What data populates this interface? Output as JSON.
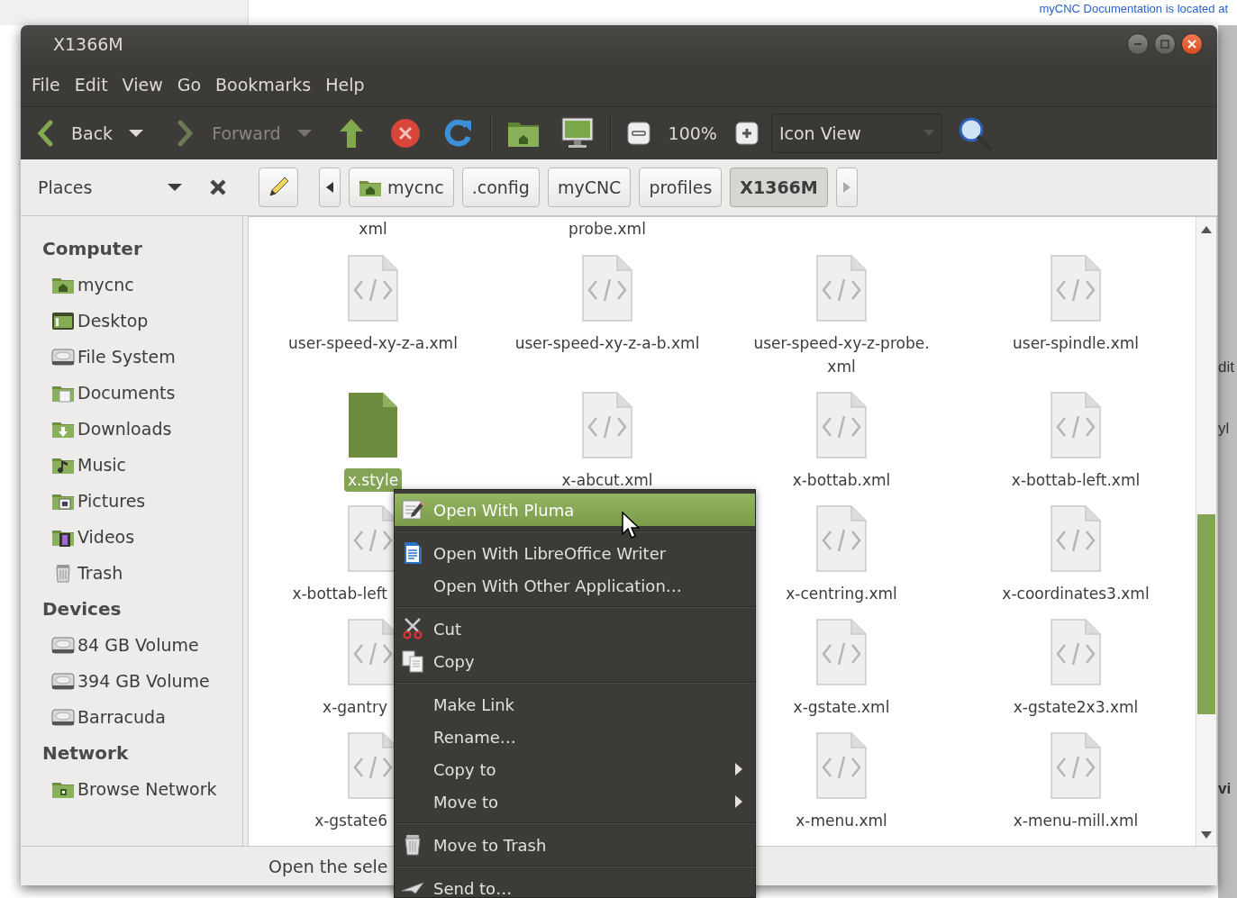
{
  "background": {
    "link_text": "myCNC Documentation is located at",
    "edge_fragments": [
      "dit",
      "yl",
      "vi"
    ]
  },
  "window": {
    "title": "X1366M"
  },
  "menubar": [
    "File",
    "Edit",
    "View",
    "Go",
    "Bookmarks",
    "Help"
  ],
  "toolbar": {
    "back": {
      "label": "Back",
      "disabled": false
    },
    "forward": {
      "label": "Forward",
      "disabled": true
    },
    "zoom_level": "100%",
    "view_mode": "Icon View"
  },
  "location_bar": {
    "places_label": "Places",
    "path": [
      {
        "label": "mycnc",
        "selected": false,
        "home": true
      },
      {
        "label": ".config",
        "selected": false,
        "home": false
      },
      {
        "label": "myCNC",
        "selected": false,
        "home": false
      },
      {
        "label": "profiles",
        "selected": false,
        "home": false
      },
      {
        "label": "X1366M",
        "selected": true,
        "home": false
      }
    ]
  },
  "sidebar": {
    "sections": [
      {
        "heading": "Computer",
        "items": [
          {
            "label": "mycnc",
            "kind": "home"
          },
          {
            "label": "Desktop",
            "kind": "desktop"
          },
          {
            "label": "File System",
            "kind": "drive"
          },
          {
            "label": "Documents",
            "kind": "documents"
          },
          {
            "label": "Downloads",
            "kind": "downloads"
          },
          {
            "label": "Music",
            "kind": "music"
          },
          {
            "label": "Pictures",
            "kind": "pictures"
          },
          {
            "label": "Videos",
            "kind": "videos"
          },
          {
            "label": "Trash",
            "kind": "trash"
          }
        ]
      },
      {
        "heading": "Devices",
        "items": [
          {
            "label": "84 GB Volume",
            "kind": "drive"
          },
          {
            "label": "394 GB Volume",
            "kind": "drive"
          },
          {
            "label": "Barracuda",
            "kind": "drive"
          }
        ]
      },
      {
        "heading": "Network",
        "items": [
          {
            "label": "Browse Network",
            "kind": "network"
          }
        ]
      }
    ]
  },
  "icon_view": {
    "rows": [
      {
        "files": [
          {
            "name": "xml",
            "kind": "label-only",
            "selected": false,
            "truncated": false
          },
          {
            "name": "probe.xml",
            "kind": "label-only",
            "selected": false,
            "truncated": false
          }
        ]
      },
      {
        "files": [
          {
            "name": "user-speed-xy-z-a.xml",
            "kind": "xml",
            "selected": false,
            "truncated": false
          },
          {
            "name": "user-speed-xy-z-a-b.xml",
            "kind": "xml",
            "selected": false,
            "truncated": false
          },
          {
            "name": "user-speed-xy-z-probe.xml",
            "kind": "xml",
            "selected": false,
            "truncated": false
          },
          {
            "name": "user-spindle.xml",
            "kind": "xml",
            "selected": false,
            "truncated": false
          }
        ]
      },
      {
        "files": [
          {
            "name": "x.style",
            "kind": "style",
            "selected": true,
            "truncated": false
          },
          {
            "name": "x-abcut.xml",
            "kind": "xml",
            "selected": false,
            "truncated": false
          },
          {
            "name": "x-bottab.xml",
            "kind": "xml",
            "selected": false,
            "truncated": false
          },
          {
            "name": "x-bottab-left.xml",
            "kind": "xml",
            "selected": false,
            "truncated": false
          }
        ]
      },
      {
        "files": [
          {
            "name": "x-bottab-left",
            "kind": "xml",
            "selected": false,
            "truncated": true
          },
          {
            "name": "x-centring.xml",
            "kind": "xml",
            "selected": false,
            "truncated": false
          },
          {
            "name": "x-coordinates3.xml",
            "kind": "xml",
            "selected": false,
            "truncated": false
          }
        ]
      },
      {
        "files": [
          {
            "name": "x-gantry",
            "kind": "xml",
            "selected": false,
            "truncated": true
          },
          {
            "name": "x-gstate.xml",
            "kind": "xml",
            "selected": false,
            "truncated": false
          },
          {
            "name": "x-gstate2x3.xml",
            "kind": "xml",
            "selected": false,
            "truncated": false
          }
        ]
      },
      {
        "files": [
          {
            "name": "x-gstate6",
            "kind": "xml",
            "selected": false,
            "truncated": true
          },
          {
            "name": "x-menu.xml",
            "kind": "xml",
            "selected": false,
            "truncated": false
          },
          {
            "name": "x-menu-mill.xml",
            "kind": "xml",
            "selected": false,
            "truncated": false
          }
        ]
      }
    ]
  },
  "status_bar": "Open the sele",
  "context_menu": {
    "groups": [
      {
        "items": [
          {
            "label": "Open With Pluma",
            "kind": "edit",
            "selected": true,
            "submenu": false
          }
        ]
      },
      {
        "items": [
          {
            "label": "Open With LibreOffice Writer",
            "kind": "writer",
            "selected": false,
            "submenu": false
          },
          {
            "label": "Open With Other Application…",
            "kind": "plain",
            "selected": false,
            "submenu": false
          }
        ]
      },
      {
        "items": [
          {
            "label": "Cut",
            "kind": "cut",
            "selected": false,
            "submenu": false
          },
          {
            "label": "Copy",
            "kind": "copy",
            "selected": false,
            "submenu": false
          }
        ]
      },
      {
        "items": [
          {
            "label": "Make Link",
            "kind": "plain",
            "selected": false,
            "submenu": false
          },
          {
            "label": "Rename…",
            "kind": "plain",
            "selected": false,
            "submenu": false
          },
          {
            "label": "Copy to",
            "kind": "plain",
            "selected": false,
            "submenu": true
          },
          {
            "label": "Move to",
            "kind": "plain",
            "selected": false,
            "submenu": true
          }
        ]
      },
      {
        "items": [
          {
            "label": "Move to Trash",
            "kind": "trash",
            "selected": false,
            "submenu": false
          }
        ]
      },
      {
        "items": [
          {
            "label": "Send to…",
            "kind": "send",
            "selected": false,
            "submenu": false
          }
        ]
      }
    ]
  }
}
